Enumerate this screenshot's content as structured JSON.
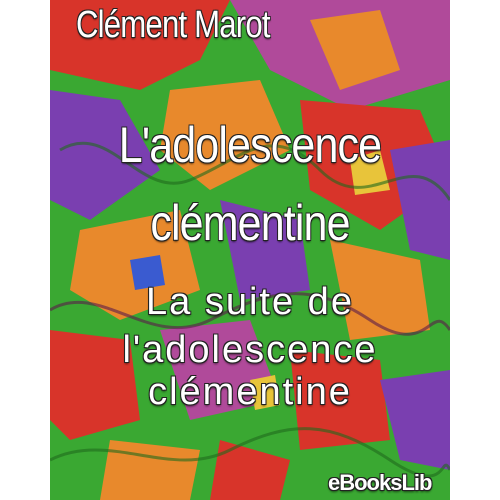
{
  "cover": {
    "author": "Clément Marot",
    "title_line1": "L'adolescence",
    "title_line2": "clémentine",
    "subtitle_line1": "La suite de",
    "subtitle_line2": "l'adolescence",
    "subtitle_line3": "clémentine",
    "publisher": "eBooksLib"
  },
  "palette": {
    "green": "#3aa832",
    "red": "#d8342a",
    "orange": "#e8892c",
    "purple": "#7a3fb0",
    "violet": "#b04a9a",
    "blue": "#3a5bd0",
    "yellow": "#e8c43a"
  }
}
